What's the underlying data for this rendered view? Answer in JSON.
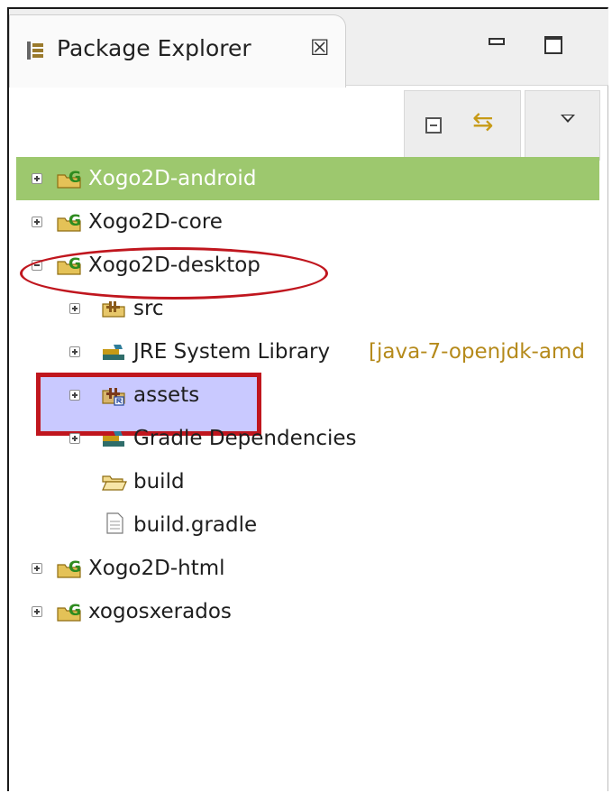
{
  "view": {
    "title": "Package Explorer",
    "close_glyph": "☒",
    "icon": "package-explorer-icon"
  },
  "window_controls": {
    "minimize": "minimize-icon",
    "maximize": "maximize-icon"
  },
  "toolbar": {
    "collapse_all": "collapse-all-icon",
    "link_with_editor": "link-with-editor-icon",
    "view_menu": "view-menu-icon"
  },
  "tree": {
    "items": [
      {
        "label": "Xogo2D-android",
        "icon": "gradle-project-icon",
        "expanded": false,
        "selected": true
      },
      {
        "label": "Xogo2D-core",
        "icon": "gradle-project-icon",
        "expanded": false
      },
      {
        "label": "Xogo2D-desktop",
        "icon": "gradle-project-icon",
        "expanded": true
      },
      {
        "label": "src",
        "icon": "source-folder-icon",
        "expanded": false
      },
      {
        "label": "JRE System Library",
        "decoration": "[java-7-openjdk-amd",
        "icon": "library-icon",
        "expanded": false
      },
      {
        "label": "assets",
        "icon": "linked-source-folder-icon",
        "expanded": false
      },
      {
        "label": "Gradle Dependencies",
        "icon": "library-icon",
        "expanded": false
      },
      {
        "label": "build",
        "icon": "folder-icon"
      },
      {
        "label": "build.gradle",
        "icon": "file-icon"
      },
      {
        "label": "Xogo2D-html",
        "icon": "gradle-project-icon",
        "expanded": false
      },
      {
        "label": "xogosxerados",
        "icon": "gradle-project-icon",
        "expanded": false
      }
    ]
  },
  "colors": {
    "selection": "#9dc86e",
    "annotation_red": "#c0161e",
    "highlight": "#b4b4ff",
    "gradle_green": "#2e8b1f"
  }
}
